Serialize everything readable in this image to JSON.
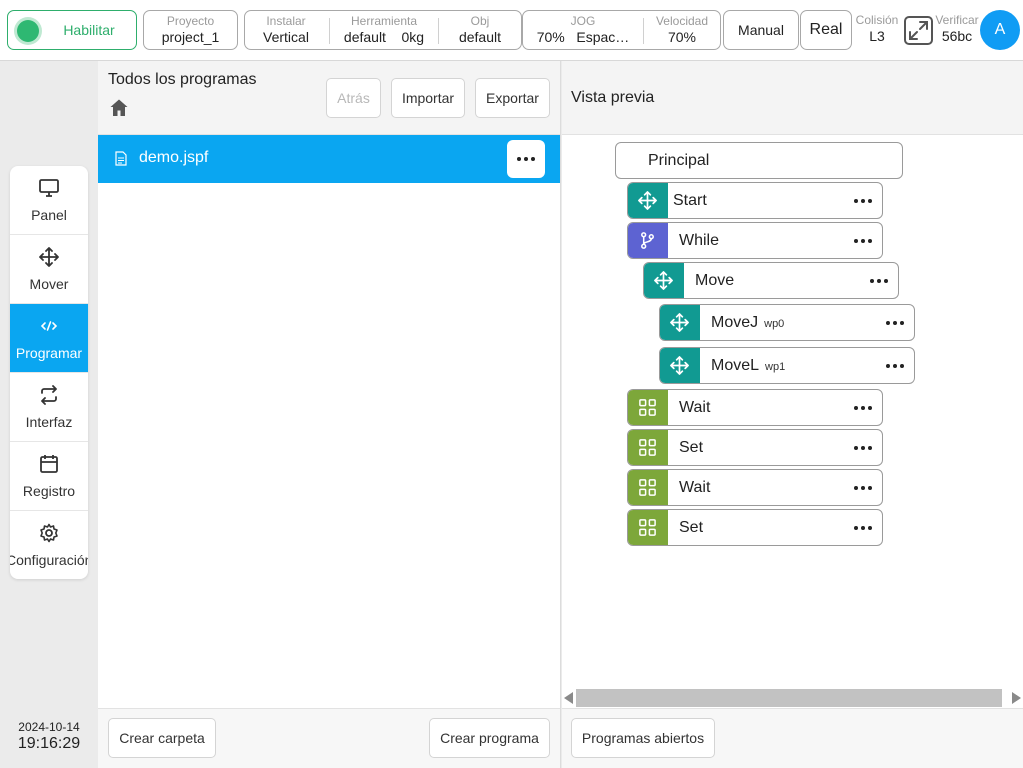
{
  "topbar": {
    "enable_label": "Habilitar",
    "project": {
      "label": "Proyecto",
      "value": "project_1"
    },
    "install": {
      "label": "Instalar",
      "value": "Vertical"
    },
    "tool": {
      "label": "Herramienta",
      "value": "default",
      "load": "0kg"
    },
    "obj": {
      "label": "Obj",
      "value": "default"
    },
    "jog": {
      "label": "JOG",
      "value": "70%",
      "mode": "Espac…"
    },
    "speed": {
      "label": "Velocidad",
      "value": "70%"
    },
    "manual_label": "Manual",
    "real_label": "Real",
    "collision": {
      "label": "Colisión",
      "value": "L3"
    },
    "verify": {
      "label": "Verificar",
      "value": "56bc"
    },
    "avatar_letter": "A"
  },
  "nav": {
    "items": [
      {
        "label": "Panel",
        "icon": "monitor-icon"
      },
      {
        "label": "Mover",
        "icon": "move-icon"
      },
      {
        "label": "Programar",
        "icon": "code-icon",
        "active": true
      },
      {
        "label": "Interfaz",
        "icon": "swap-icon"
      },
      {
        "label": "Registro",
        "icon": "calendar-icon"
      },
      {
        "label": "Configuración",
        "icon": "gear-icon"
      }
    ],
    "date": "2024-10-14",
    "time": "19:16:29"
  },
  "files_panel": {
    "title": "Todos los programas",
    "back_label": "Atrás",
    "import_label": "Importar",
    "export_label": "Exportar",
    "files": [
      {
        "name": "demo.jspf"
      }
    ],
    "create_folder_label": "Crear carpeta",
    "create_program_label": "Crear programa"
  },
  "preview_panel": {
    "title": "Vista previa",
    "root_label": "Principal",
    "nodes": [
      {
        "label": "Start",
        "sub": "",
        "icon": "move-icon",
        "color": "#119a92"
      },
      {
        "label": "While",
        "sub": "",
        "icon": "branch-icon",
        "color": "#5d63d2"
      },
      {
        "label": "Move",
        "sub": "",
        "icon": "move-icon",
        "color": "#119a92"
      },
      {
        "label": "MoveJ",
        "sub": "wp0",
        "icon": "move-icon",
        "color": "#119a92"
      },
      {
        "label": "MoveL",
        "sub": "wp1",
        "icon": "move-icon",
        "color": "#119a92"
      },
      {
        "label": "Wait",
        "sub": "",
        "icon": "grid-icon",
        "color": "#7da73a"
      },
      {
        "label": "Set",
        "sub": "",
        "icon": "grid-icon",
        "color": "#7da73a"
      },
      {
        "label": "Wait",
        "sub": "",
        "icon": "grid-icon",
        "color": "#7da73a"
      },
      {
        "label": "Set",
        "sub": "",
        "icon": "grid-icon",
        "color": "#7da73a"
      }
    ],
    "open_programs_label": "Programas abiertos"
  },
  "colors": {
    "accent": "#0aa6f1",
    "enable_green": "#2eb872",
    "move_teal": "#119a92",
    "while_purple": "#5d63d2",
    "io_green": "#7da73a"
  }
}
